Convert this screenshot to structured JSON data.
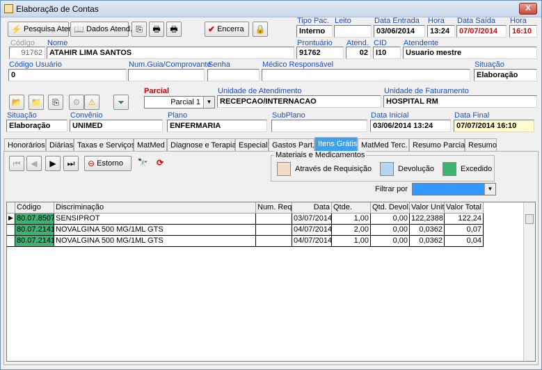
{
  "window": {
    "title": "Elaboração de Contas",
    "close_label": "X"
  },
  "toolbar": {
    "pesquisa_label": "Pesquisa Atend.",
    "dados_label": "Dados Atend.",
    "encerra_label": "Encerra"
  },
  "header": {
    "tipo_pac_label": "Tipo Pac.",
    "tipo_pac": "Interno",
    "leito_label": "Leito",
    "leito": "",
    "data_entrada_label": "Data Entrada",
    "data_entrada": "03/06/2014",
    "hora_label": "Hora",
    "hora_entrada": "13:24",
    "data_saida_label": "Data Saída",
    "data_saida": "07/07/2014",
    "hora2_label": "Hora",
    "hora_saida": "16:10",
    "codigo_label": "Código",
    "codigo": "91762",
    "nome_label": "Nome",
    "nome": "ATAHIR LIMA SANTOS",
    "prontuario_label": "Prontuário",
    "prontuario": "91762",
    "atend_label": "Atend.",
    "atend": "02",
    "cid_label": "CID",
    "cid": "I10",
    "atendente_label": "Atendente",
    "atendente": "Usuario mestre",
    "codigo_usuario_label": "Código Usuário",
    "codigo_usuario": "0",
    "num_guia_label": "Num.Guia/Comprovante",
    "num_guia": "",
    "senha_label": "Senha",
    "senha": "",
    "medico_label": "Médico Responsável",
    "medico": "",
    "situacao_label": "Situação",
    "situacao": "Elaboração"
  },
  "parcial": {
    "parcial_label": "Parcial",
    "parcial_value": "Parcial 1",
    "unidade_atend_label": "Unidade de Atendimento",
    "unidade_atend": "RECEPCAO/INTERNACAO",
    "unidade_fat_label": "Unidade de Faturamento",
    "unidade_fat": "HOSPITAL RM",
    "situacao_label": "Situação",
    "situacao": "Elaboração",
    "convenio_label": "Convênio",
    "convenio": "UNIMED",
    "plano_label": "Plano",
    "plano": "ENFERMARIA",
    "subplano_label": "SubPlano",
    "subplano": "",
    "data_inicial_label": "Data Inicial",
    "data_inicial": "03/06/2014 13:24",
    "data_final_label": "Data Final",
    "data_final": "07/07/2014 16:10"
  },
  "tabs": [
    {
      "label": "Honorários"
    },
    {
      "label": "Diárias"
    },
    {
      "label": "Taxas e Serviços"
    },
    {
      "label": "MatMed"
    },
    {
      "label": "Diagnose e Terapia"
    },
    {
      "label": "Especial"
    },
    {
      "label": "Gastos Part."
    },
    {
      "label": "Itens Grátis"
    },
    {
      "label": "MatMed Terc."
    },
    {
      "label": "Resumo Parcial"
    },
    {
      "label": "Resumo"
    }
  ],
  "navigator": {
    "estorno_label": "Estorno"
  },
  "legend": {
    "title": "Materiais e Medicamentos",
    "requisicao": "Através de Requisição",
    "devolucao": "Devolução",
    "excedido": "Excedido",
    "colors": {
      "requisicao": "#f3dcc7",
      "devolucao": "#b7d3f2",
      "excedido": "#3cb371"
    }
  },
  "filter": {
    "label": "Filtrar por",
    "value": ""
  },
  "table": {
    "headers": [
      "Código",
      "Discriminação",
      "Num. Req.",
      "Data",
      "Qtde.",
      "Qtd. Devol.",
      "Valor Unit.",
      "Valor Total"
    ],
    "rows": [
      [
        "80.07.8507",
        "SENSIPROT",
        "",
        "03/07/2014",
        "1,00",
        "0,00",
        "122,2388",
        "122,24"
      ],
      [
        "80.07.2141",
        "NOVALGINA 500 MG/1ML GTS",
        "",
        "04/07/2014",
        "2,00",
        "0,00",
        "0,0362",
        "0,07"
      ],
      [
        "80.07.2141",
        "NOVALGINA 500 MG/1ML GTS",
        "",
        "04/07/2014",
        "1,00",
        "0,00",
        "0,0362",
        "0,04"
      ]
    ]
  }
}
